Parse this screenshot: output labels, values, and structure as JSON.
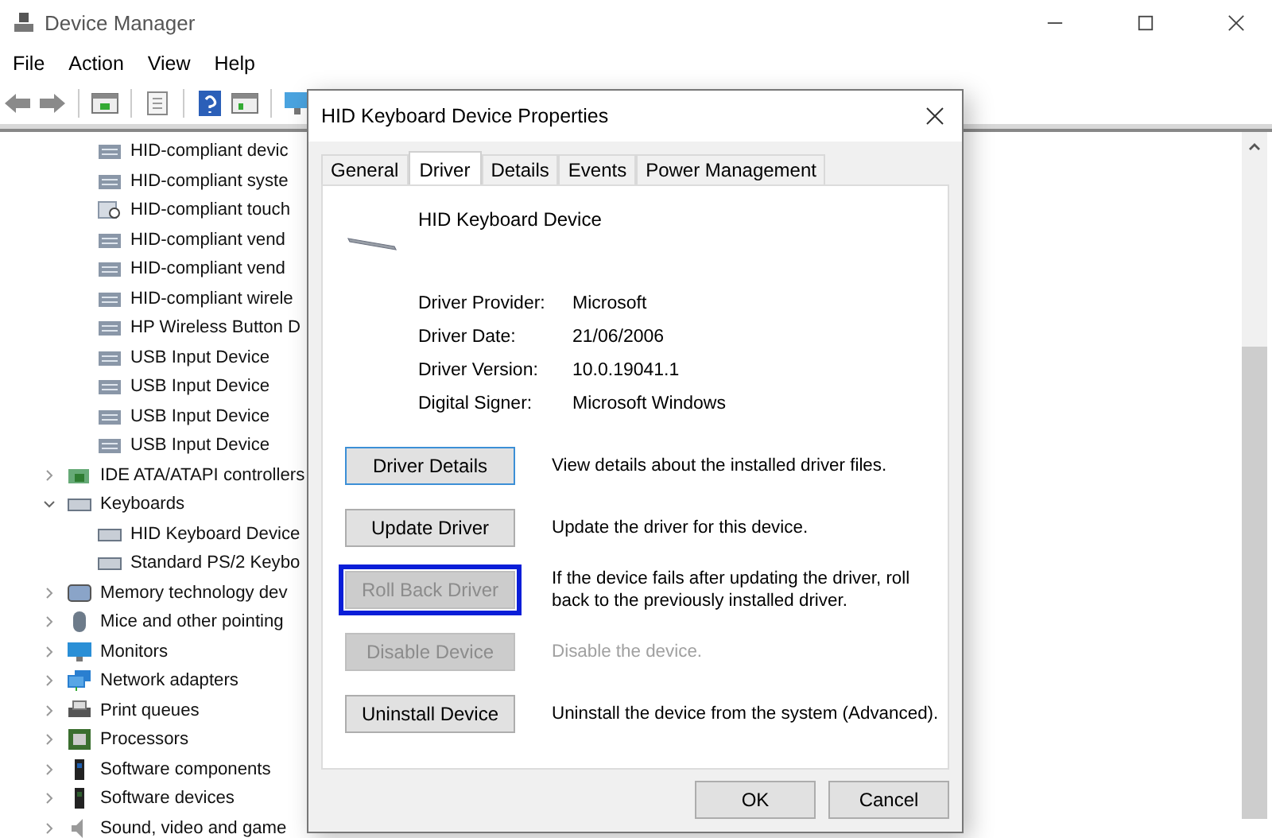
{
  "window": {
    "title": "Device Manager"
  },
  "menu": [
    "File",
    "Action",
    "View",
    "Help"
  ],
  "tree": {
    "continued_children": [
      {
        "label": "HID-compliant devic",
        "kind": "hid"
      },
      {
        "label": "HID-compliant syste",
        "kind": "hid"
      },
      {
        "label": "HID-compliant touch",
        "kind": "touch"
      },
      {
        "label": "HID-compliant vend",
        "kind": "hid"
      },
      {
        "label": "HID-compliant vend",
        "kind": "hid"
      },
      {
        "label": "HID-compliant wirele",
        "kind": "hid"
      },
      {
        "label": "HP Wireless Button D",
        "kind": "hid"
      },
      {
        "label": "USB Input Device",
        "kind": "hid"
      },
      {
        "label": "USB Input Device",
        "kind": "hid"
      },
      {
        "label": "USB Input Device",
        "kind": "hid"
      },
      {
        "label": "USB Input Device",
        "kind": "hid"
      }
    ],
    "items": [
      {
        "label": "IDE ATA/ATAPI controllers",
        "kind": "ide",
        "expanded": false
      },
      {
        "label": "Keyboards",
        "kind": "keyboard",
        "expanded": true,
        "children": [
          {
            "label": "HID Keyboard Device",
            "kind": "keyboard"
          },
          {
            "label": "Standard PS/2 Keybo",
            "kind": "keyboard"
          }
        ]
      },
      {
        "label": "Memory technology dev",
        "kind": "memory",
        "expanded": false
      },
      {
        "label": "Mice and other pointing",
        "kind": "mouse",
        "expanded": false
      },
      {
        "label": "Monitors",
        "kind": "monitor",
        "expanded": false
      },
      {
        "label": "Network adapters",
        "kind": "network",
        "expanded": false
      },
      {
        "label": "Print queues",
        "kind": "printer",
        "expanded": false
      },
      {
        "label": "Processors",
        "kind": "processor",
        "expanded": false
      },
      {
        "label": "Software components",
        "kind": "component",
        "expanded": false
      },
      {
        "label": "Software devices",
        "kind": "software",
        "expanded": false
      },
      {
        "label": "Sound, video and game",
        "kind": "sound",
        "expanded": false
      }
    ]
  },
  "dialog": {
    "title": "HID Keyboard Device Properties",
    "tabs": [
      {
        "label": "General",
        "selected": false
      },
      {
        "label": "Driver",
        "selected": true
      },
      {
        "label": "Details",
        "selected": false
      },
      {
        "label": "Events",
        "selected": false
      },
      {
        "label": "Power Management",
        "selected": false
      }
    ],
    "device_name": "HID Keyboard Device",
    "properties": [
      {
        "label": "Driver Provider:",
        "value": "Microsoft"
      },
      {
        "label": "Driver Date:",
        "value": "21/06/2006"
      },
      {
        "label": "Driver Version:",
        "value": "10.0.19041.1"
      },
      {
        "label": "Digital Signer:",
        "value": "Microsoft Windows"
      }
    ],
    "actions": [
      {
        "label": "Driver Details",
        "disabled": false,
        "focused": false,
        "description": "View details about the installed driver files.",
        "description_disabled": false
      },
      {
        "label": "Update Driver",
        "disabled": false,
        "focused": false,
        "description": "Update the driver for this device.",
        "description_disabled": false
      },
      {
        "label": "Roll Back Driver",
        "disabled": true,
        "focused": true,
        "description": "If the device fails after updating the driver, roll back to the previously installed driver.",
        "description_disabled": false
      },
      {
        "label": "Disable Device",
        "disabled": true,
        "focused": false,
        "description": "Disable the device.",
        "description_disabled": true
      },
      {
        "label": "Uninstall Device",
        "disabled": false,
        "focused": false,
        "description": "Uninstall the device from the system (Advanced).",
        "description_disabled": false
      }
    ],
    "buttons": [
      "OK",
      "Cancel"
    ]
  }
}
